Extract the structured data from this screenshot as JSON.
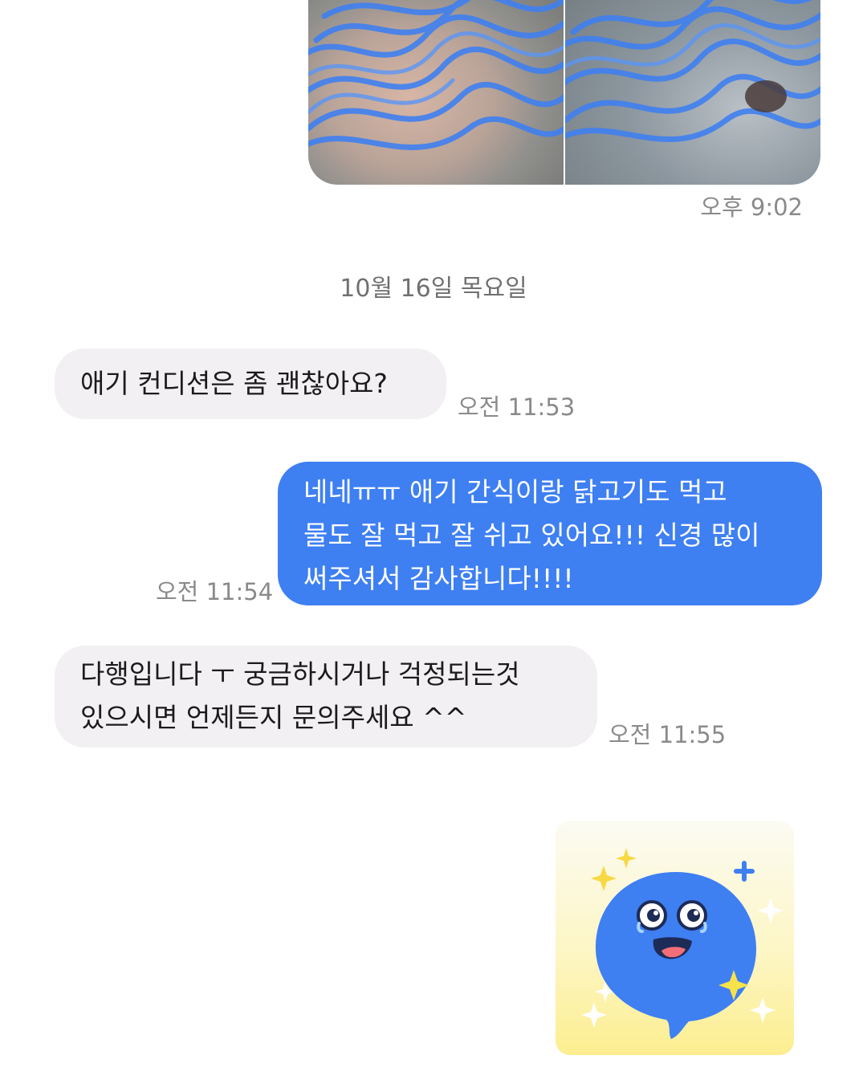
{
  "conversation": {
    "photo_message": {
      "time": "오후 9:02"
    },
    "date_divider": "10월 16일 목요일",
    "messages": [
      {
        "lines": [
          "애기 컨디션은 좀 괜찮아요?"
        ],
        "time": "오전 11:53"
      },
      {
        "lines": [
          "네네ㅠㅠ 애기 간식이랑 닭고기도 먹고",
          "물도 잘 먹고 잘 쉬고 있어요!!! 신경 많이",
          "써주셔서 감사합니다!!!!"
        ],
        "time": "오전 11:54"
      },
      {
        "lines": [
          "다행입니다 ㅜ 궁금하시거나 걱정되는것",
          "있으시면 언제든지 문의주세요 ^^"
        ],
        "time": "오전 11:55"
      }
    ],
    "sticker": {
      "icon": "happy-speech-bubble-sticker"
    }
  },
  "colors": {
    "outgoing_bubble": "#3e7ff2",
    "incoming_bubble": "#f3f0f3",
    "timestamp": "#8a8a8a",
    "scribble": "#3f7ff0"
  }
}
